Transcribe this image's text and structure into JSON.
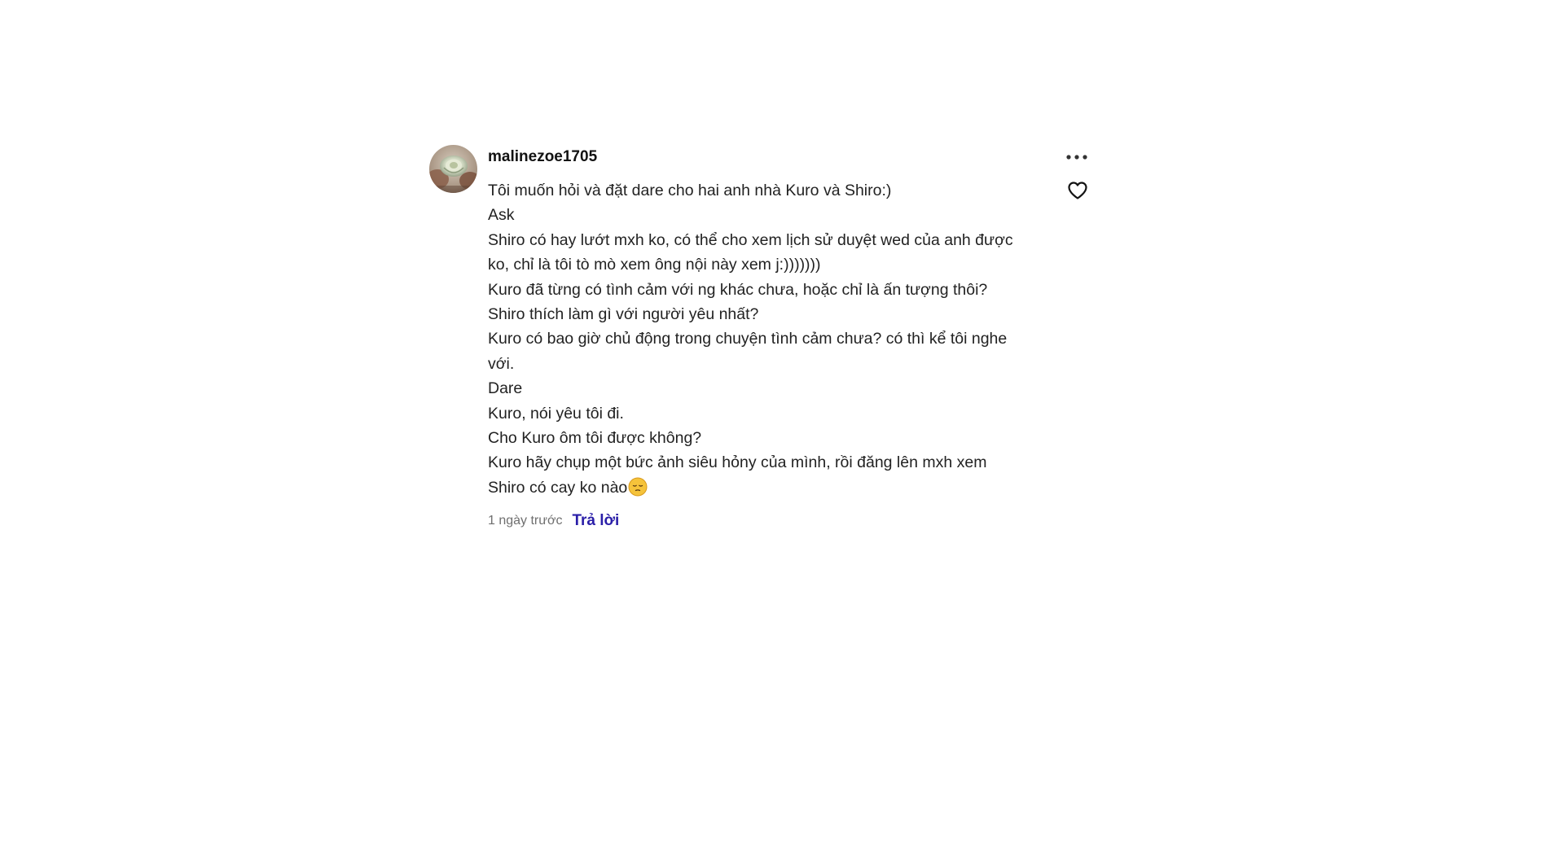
{
  "comment": {
    "username": "malinezoe1705",
    "avatar_icon": "avatar-photo",
    "lines": [
      "Tôi muốn hỏi và đặt dare cho hai anh nhà Kuro và Shiro:)",
      "Ask",
      "Shiro có hay lướt mxh ko, có thể cho xem lịch sử duyệt wed của anh được",
      "ko, chỉ là tôi tò mò xem ông nội này xem j:)))))))",
      "Kuro đã từng có tình cảm với ng khác chưa, hoặc chỉ là ấn tượng thôi?",
      "Shiro thích làm gì với người yêu nhất?",
      "Kuro có bao giờ chủ động trong chuyện tình cảm chưa? có thì kể tôi nghe",
      "với.",
      "Dare",
      "Kuro, nói yêu tôi đi.",
      "Cho Kuro ôm tôi được không?",
      "Kuro hãy chụp một bức ảnh siêu hỏny của mình, rồi đăng lên mxh xem",
      "Shiro có cay ko nào"
    ],
    "trailing_emoji": "pensive-face-emoji",
    "timestamp": "1 ngày trước",
    "reply_label": "Trả lời",
    "more_icon": "more-options-icon",
    "like_icon": "heart-icon"
  },
  "colors": {
    "text": "#222222",
    "username": "#121212",
    "meta": "#6f6f6f",
    "reply": "#2a1ea8"
  }
}
